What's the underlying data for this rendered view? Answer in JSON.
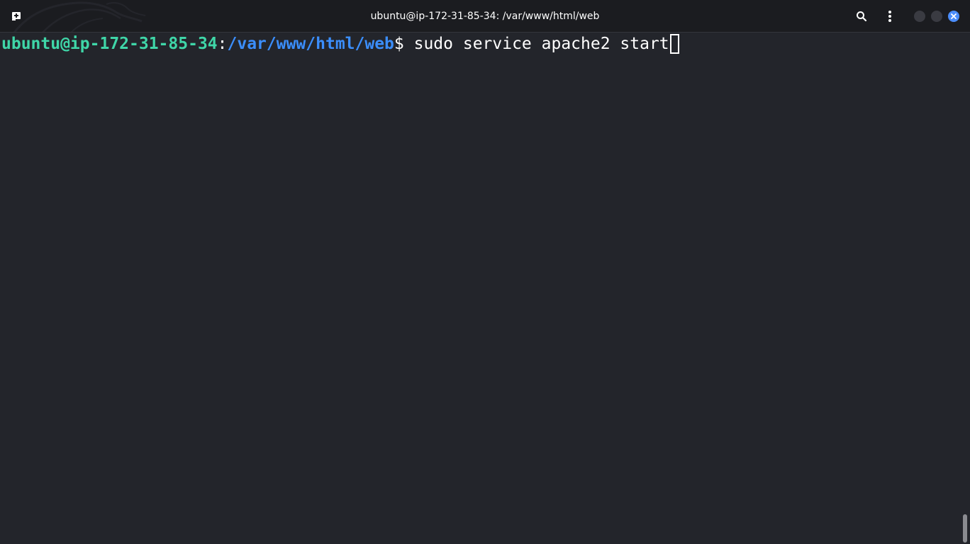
{
  "window": {
    "title": "ubuntu@ip-172-31-85-34: /var/www/html/web"
  },
  "terminal": {
    "prompt_user_host": "ubuntu@ip-172-31-85-34",
    "prompt_separator": ":",
    "prompt_path": "/var/www/html/web",
    "prompt_symbol": "$ ",
    "command": "sudo service apache2 start"
  },
  "icons": {
    "new_tab": "new-tab-icon",
    "search": "search-icon",
    "menu": "kebab-menu-icon",
    "minimize": "minimize-icon",
    "maximize": "maximize-icon",
    "close": "close-icon"
  },
  "colors": {
    "background": "#23252b",
    "titlebar": "#1b1c20",
    "user_host": "#3fd6a8",
    "path": "#3b8efc",
    "text": "#ffffff",
    "close_button": "#4b8dfb"
  }
}
